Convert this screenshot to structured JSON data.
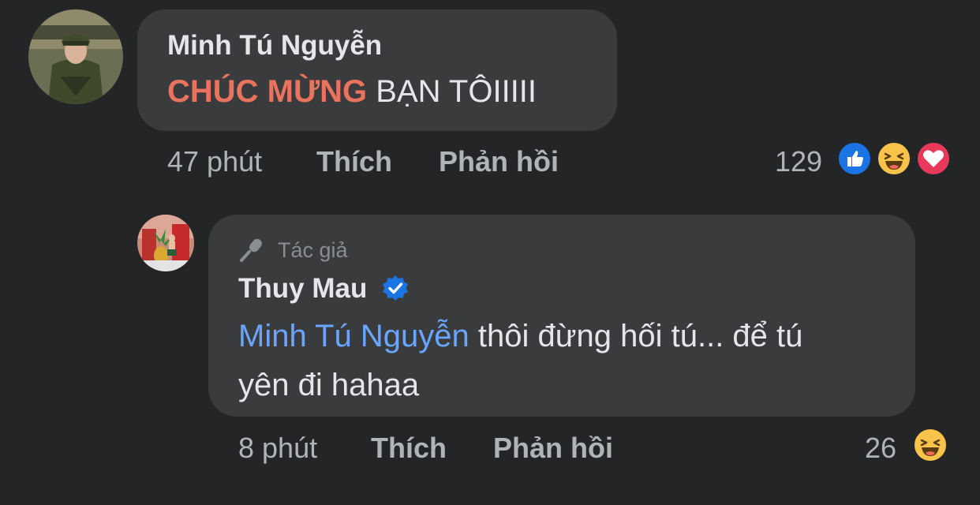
{
  "comment": {
    "author": "Minh Tú Nguyễn",
    "text_highlight": "CHÚC MỪNG",
    "text_rest": " BẠN TÔIIIII",
    "time": "47 phút",
    "like_label": "Thích",
    "reply_label": "Phản hồi",
    "reaction_count": "129",
    "reactions": [
      "like-icon",
      "haha-icon",
      "love-icon"
    ]
  },
  "reply": {
    "badge": "Tác giả",
    "author": "Thuy Mau",
    "verified": true,
    "mention": "Minh Tú Nguyễn",
    "text_line1": " thôi đừng hối tú... để tú",
    "text_line2": "yên đi hahaa",
    "time": "8 phút",
    "like_label": "Thích",
    "reply_label": "Phản hồi",
    "reaction_count": "26",
    "reactions": [
      "haha-icon"
    ]
  },
  "colors": {
    "background": "#242526",
    "bubble": "#3a3b3c",
    "highlight": "#e9735e",
    "mention": "#6aa6ff",
    "verified": "#1b74e4"
  }
}
